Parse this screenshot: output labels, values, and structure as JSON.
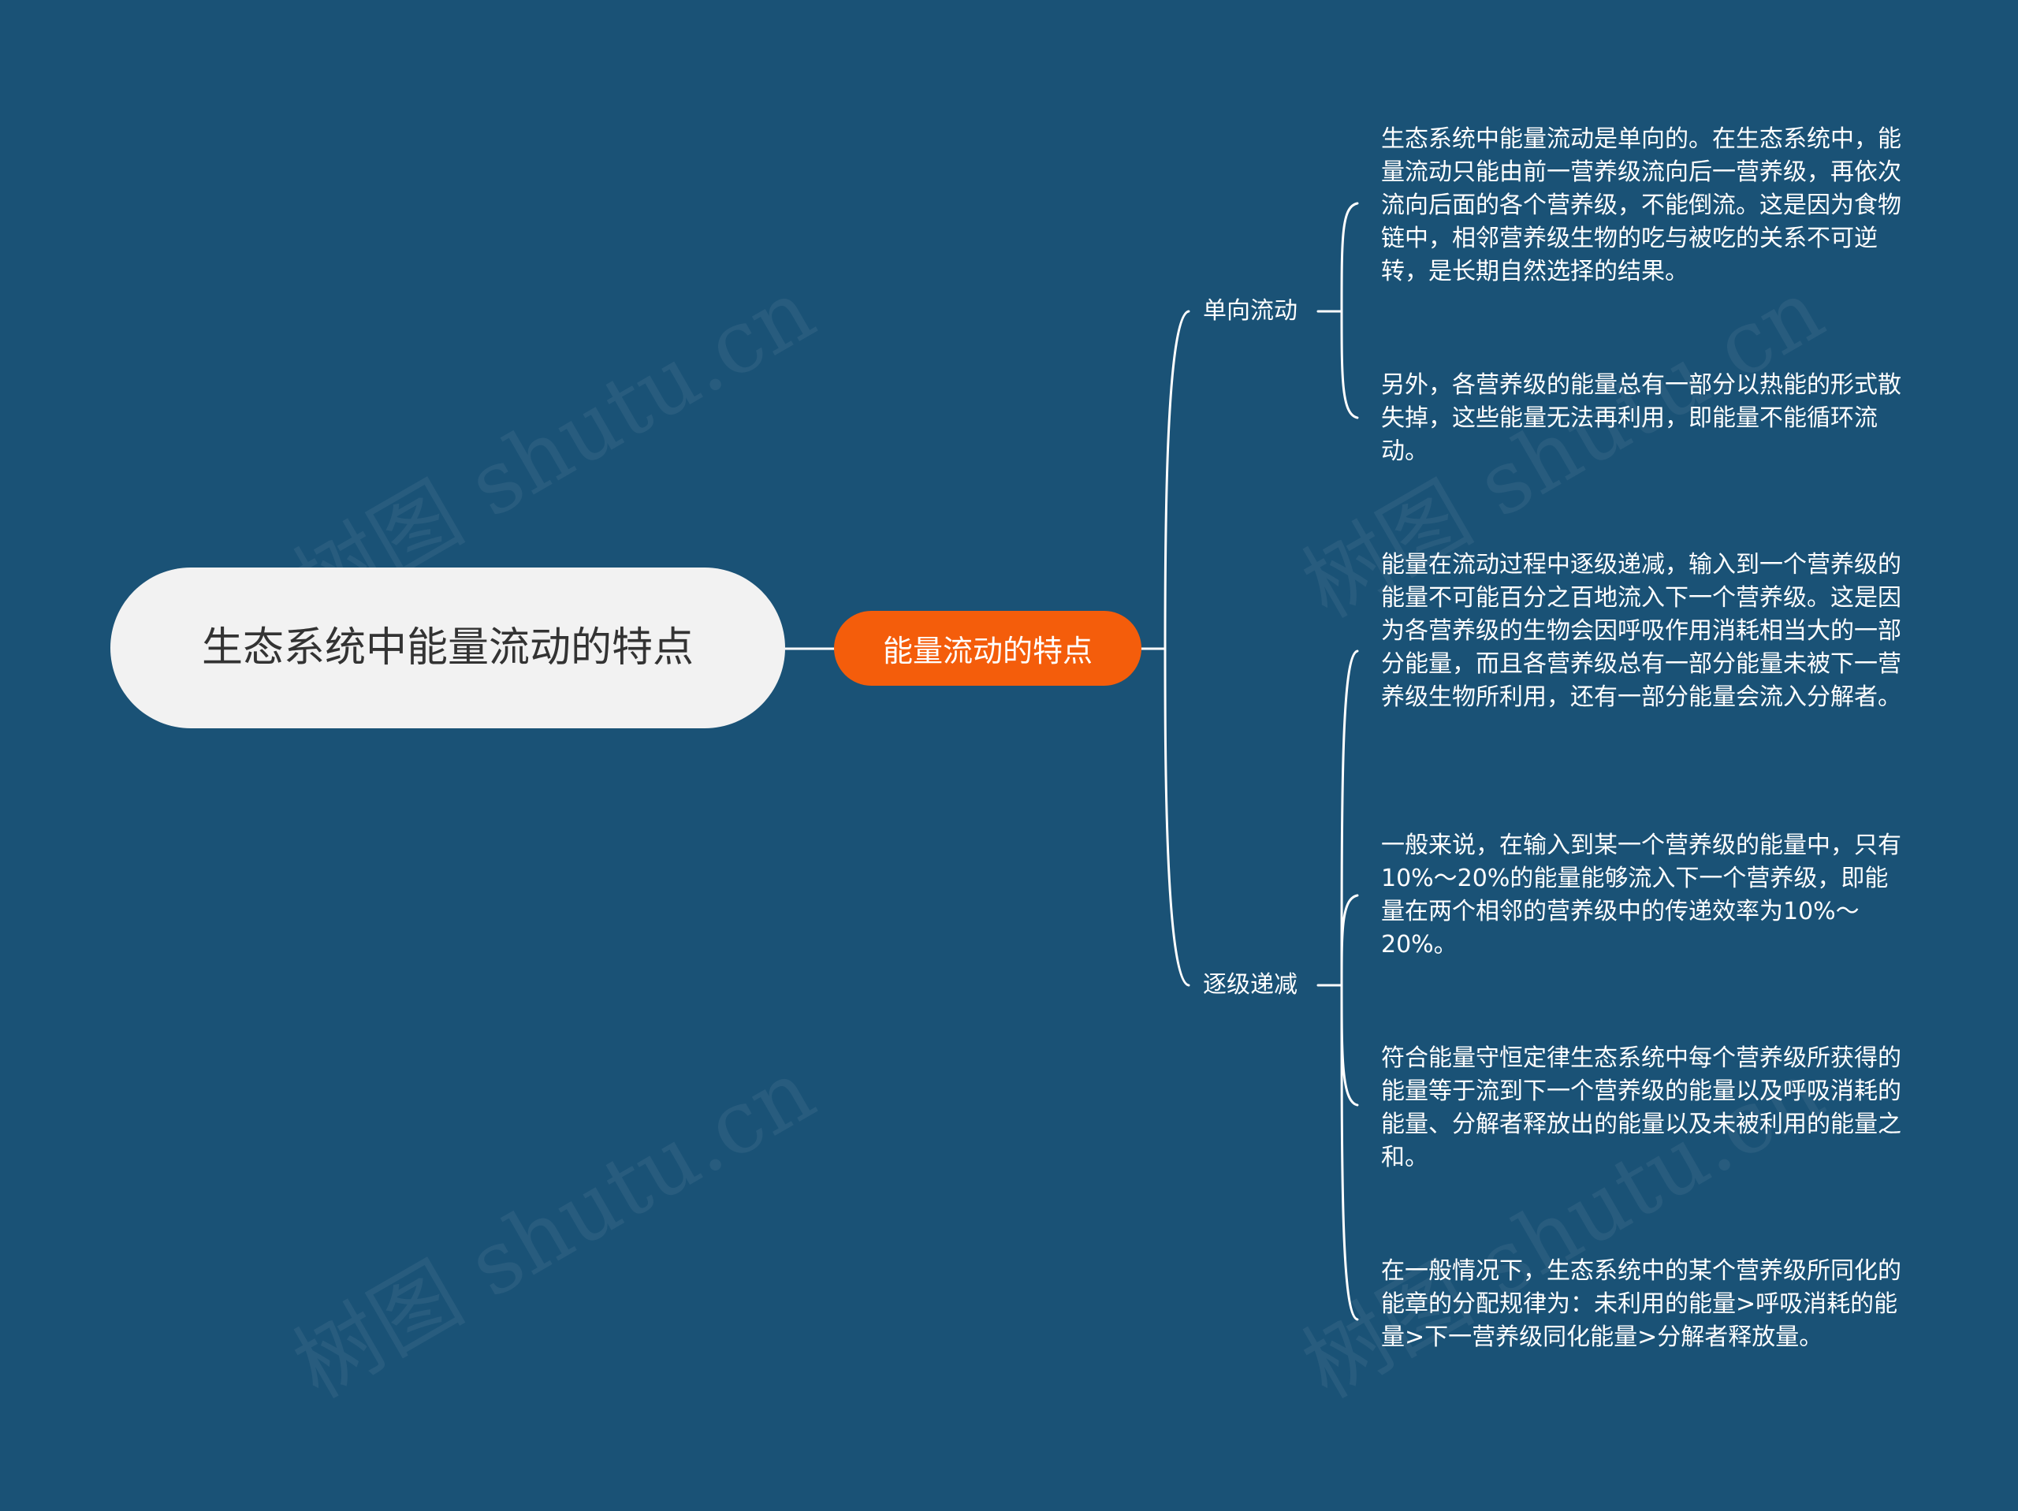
{
  "mindmap": {
    "root": {
      "label": "生态系统中能量流动的特点"
    },
    "center": {
      "label": "能量流动的特点"
    },
    "branches": [
      {
        "label": "单向流动",
        "leaves": [
          "生态系统中能量流动是单向的。在生态系统中，能量流动只能由前一营养级流向后一营养级，再依次流向后面的各个营养级，不能倒流。这是因为食物链中，相邻营养级生物的吃与被吃的关系不可逆转，是长期自然选择的结果。",
          "另外，各营养级的能量总有一部分以热能的形式散失掉，这些能量无法再利用，即能量不能循环流动。"
        ]
      },
      {
        "label": "逐级递减",
        "leaves": [
          "能量在流动过程中逐级递减，输入到一个营养级的能量不可能百分之百地流入下一个营养级。这是因为各营养级的生物会因呼吸作用消耗相当大的一部分能量，而且各营养级总有一部分能量未被下一营养级生物所利用，还有一部分能量会流入分解者。",
          "一般来说，在输入到某一个营养级的能量中，只有10%～20%的能量能够流入下一个营养级，即能量在两个相邻的营养级中的传递效率为10%～20%。",
          "符合能量守恒定律生态系统中每个营养级所获得的能量等于流到下一个营养级的能量以及呼吸消耗的能量、分解者释放出的能量以及未被利用的能量之和。",
          "在一般情况下，生态系统中的某个营养级所同化的能章的分配规律为：未利用的能量>呼吸消耗的能量>下一营养级同化能量>分解者释放量。"
        ]
      }
    ]
  },
  "watermark": {
    "text": "树图 shutu.cn"
  },
  "colors": {
    "background": "#1a5276",
    "root_fill": "#f2f2f2",
    "center_fill": "#f45d0b",
    "line": "#ffffff"
  }
}
